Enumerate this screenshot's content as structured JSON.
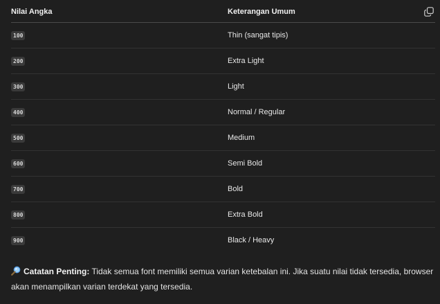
{
  "table": {
    "headers": [
      "Nilai Angka",
      "Keterangan Umum"
    ],
    "copy_icon": "copy-icon",
    "rows": [
      {
        "value": "100",
        "desc": "Thin (sangat tipis)"
      },
      {
        "value": "200",
        "desc": "Extra Light"
      },
      {
        "value": "300",
        "desc": "Light"
      },
      {
        "value": "400",
        "desc": "Normal / Regular"
      },
      {
        "value": "500",
        "desc": "Medium"
      },
      {
        "value": "600",
        "desc": "Semi Bold"
      },
      {
        "value": "700",
        "desc": "Bold"
      },
      {
        "value": "800",
        "desc": "Extra Bold"
      },
      {
        "value": "900",
        "desc": "Black / Heavy"
      }
    ]
  },
  "note": {
    "icon": "magnifier-icon",
    "label": "Catatan Penting:",
    "text": " Tidak semua font memiliki semua varian ketebalan ini. Jika suatu nilai tidak tersedia, browser akan menampilkan varian terdekat yang tersedia."
  },
  "colors": {
    "background": "#1f1f1f",
    "code_bg": "#3a3a3a",
    "icon_blue": "#5aa0e6"
  }
}
